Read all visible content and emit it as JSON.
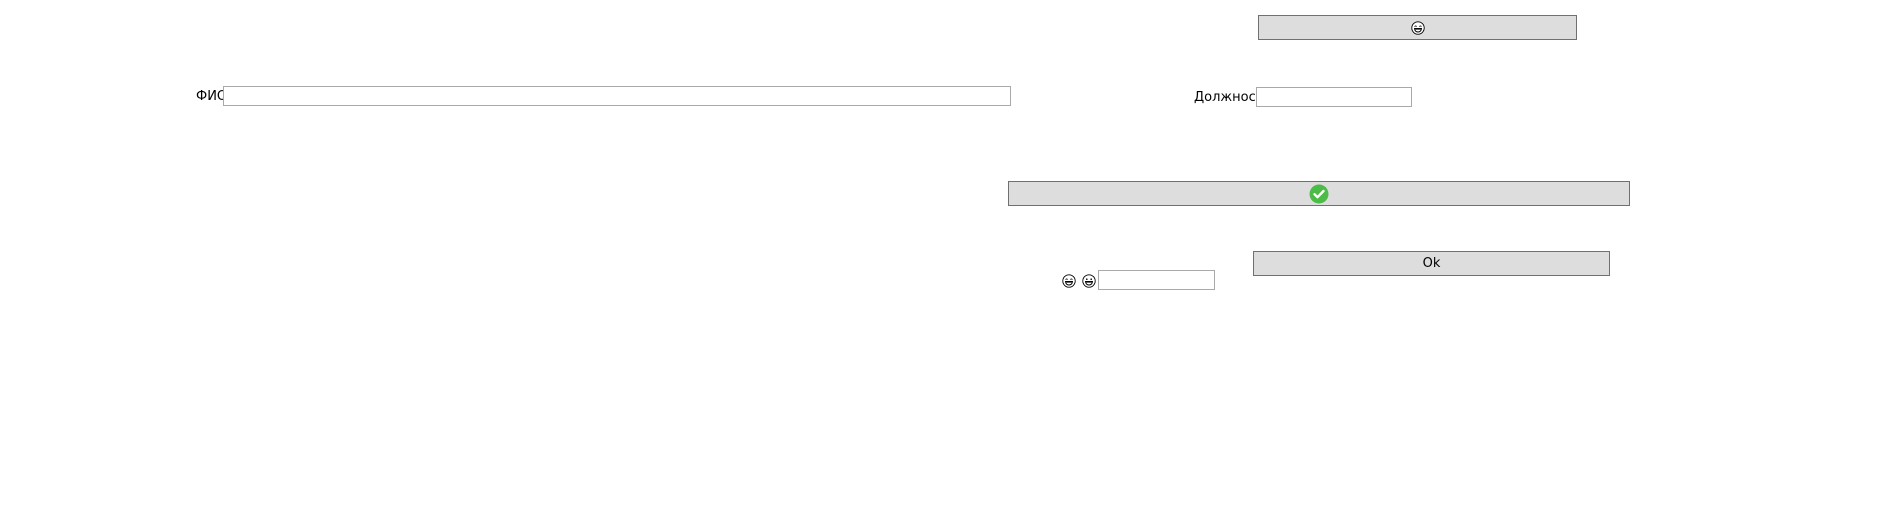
{
  "top_button": {
    "icon": "laughing-face-icon"
  },
  "fio_field": {
    "label": "ФИО",
    "value": ""
  },
  "position_field": {
    "label": "Должность",
    "value": ""
  },
  "confirm_button": {
    "icon": "green-checkmark-icon",
    "accent": "#4cbb47"
  },
  "ok_button": {
    "label": "Ok"
  },
  "emoji_row": {
    "icons": [
      "laughing-face-icon",
      "grinning-face-icon"
    ],
    "value": ""
  }
}
